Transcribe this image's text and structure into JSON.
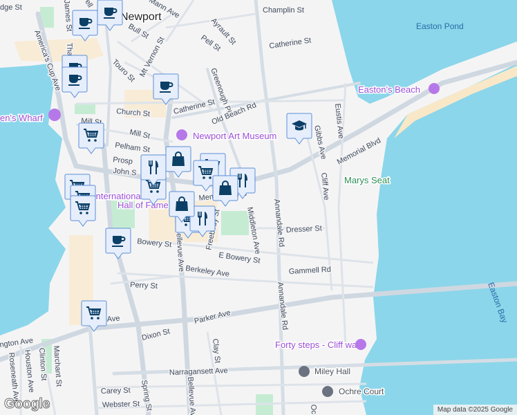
{
  "city_label": "Newport",
  "streets": [
    "Champlin St",
    "Catherine St",
    "Ayrault St",
    "Pell St",
    "Bull St",
    "Mt Vernon St",
    "Touro St",
    "Greenough Pl",
    "Church St",
    "Catherine St",
    "Old Beach Rd",
    "Mill St",
    "Mill St",
    "Pelham St",
    "Prosp",
    "John S",
    "Memorial Blvd",
    "Memorial Blvd",
    "Gibbs Ave",
    "Eustis Ave",
    "Cliff Ave",
    "Middleton Ave",
    "Annandale Rd",
    "Annandale Rd",
    "Dresser St",
    "Freebody St",
    "Bowery St",
    "E Bowery St",
    "Gammell Rd",
    "Berkeley Ave",
    "Perry St",
    "Parker Ave",
    "Dixon St",
    "Clay St",
    "Narragansett Ave",
    "Carey St",
    "Webster St",
    "Spring St",
    "Bellevue Ave",
    "Bellevue Ave",
    "America's Cup Ave",
    "Thames St",
    "James St",
    "Mann Ave",
    "ngton Ave",
    "Marchant St",
    "Clinton St",
    "Houston Ave",
    "Roseneath Ave",
    "Ave",
    "Oc",
    "dge St",
    "ell"
  ],
  "pois": {
    "wharf": "en's Wharf",
    "museum": "Newport Art Museum",
    "beach": "Easton's Beach",
    "forty_steps": "Forty steps - Cliff walk",
    "hall_1": "International",
    "hall_2": "Hall of Fame",
    "marys_seat": "Marys Seat",
    "miley_hall": "Miley Hall",
    "ochre_court": "Ochre Court"
  },
  "water_labels": {
    "pond": "Easton Pond",
    "bay": "Easton Bay"
  },
  "markers": [
    {
      "type": "coffee"
    },
    {
      "type": "coffee"
    },
    {
      "type": "coffee"
    },
    {
      "type": "coffee"
    },
    {
      "type": "coffee"
    },
    {
      "type": "coffee"
    },
    {
      "type": "cart"
    },
    {
      "type": "cart"
    },
    {
      "type": "cart"
    },
    {
      "type": "cart"
    },
    {
      "type": "cart"
    },
    {
      "type": "cart"
    },
    {
      "type": "cart"
    },
    {
      "type": "cart"
    },
    {
      "type": "cart"
    },
    {
      "type": "restaurant"
    },
    {
      "type": "restaurant"
    },
    {
      "type": "restaurant"
    },
    {
      "type": "shopping"
    },
    {
      "type": "shopping"
    },
    {
      "type": "shopping"
    },
    {
      "type": "school"
    }
  ],
  "logo": "Google",
  "attribution": "Map data ©2025 Google",
  "colors": {
    "water": "#8bd6ea",
    "land": "#f5f4f5",
    "park": "#c5ecd3",
    "commercial": "#f8ecd7",
    "marker_fill": "#e6eefc",
    "marker_border": "#5b8ed6",
    "marker_icon": "#0b3f66",
    "poi": "#9b4fd6"
  }
}
